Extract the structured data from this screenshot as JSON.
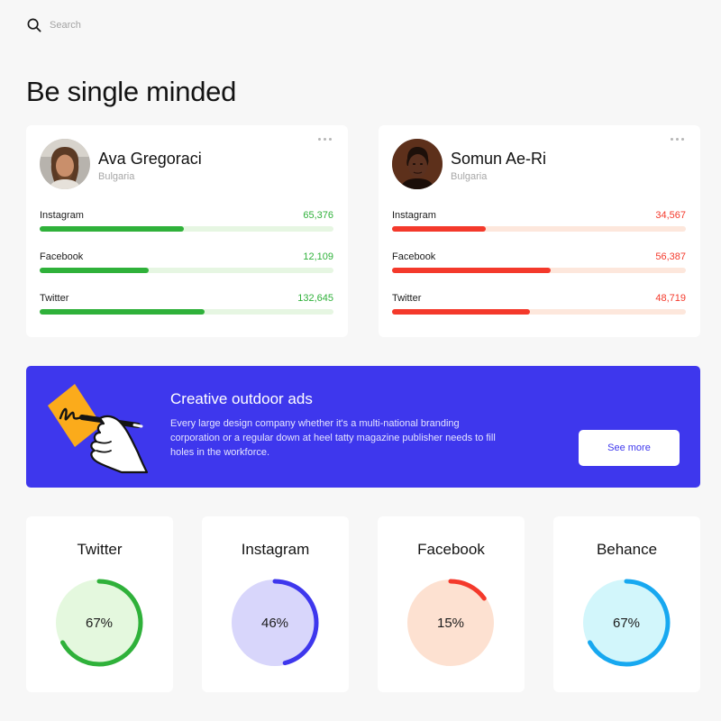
{
  "search": {
    "placeholder": "Search"
  },
  "page": {
    "title": "Be single minded"
  },
  "profiles": [
    {
      "name": "Ava Gregoraci",
      "country": "Bulgaria",
      "accent": "#2fb13a",
      "track": "#e6f6e2",
      "stats": [
        {
          "label": "Instagram",
          "value": "65,376",
          "fill": 0.49
        },
        {
          "label": "Facebook",
          "value": "12,109",
          "fill": 0.37
        },
        {
          "label": "Twitter",
          "value": "132,645",
          "fill": 0.56
        }
      ]
    },
    {
      "name": "Somun Ae-Ri",
      "country": "Bulgaria",
      "accent": "#f4392b",
      "track": "#fde7dc",
      "stats": [
        {
          "label": "Instagram",
          "value": "34,567",
          "fill": 0.32
        },
        {
          "label": "Facebook",
          "value": "56,387",
          "fill": 0.54
        },
        {
          "label": "Twitter",
          "value": "48,719",
          "fill": 0.47
        }
      ]
    }
  ],
  "promo": {
    "title": "Creative outdoor ads",
    "text": "Every large design company whether it's a multi-national branding corporation or a regular down at heel tatty magazine publisher needs to fill holes in the workforce.",
    "button": "See more",
    "background": "#3e37ed"
  },
  "rings": [
    {
      "title": "Twitter",
      "label": "67%",
      "percent": 67,
      "color": "#2fb13a",
      "fill_color": "#e4f8de"
    },
    {
      "title": "Instagram",
      "label": "46%",
      "percent": 46,
      "color": "#3e37ed",
      "fill_color": "#d8d6fb"
    },
    {
      "title": "Facebook",
      "label": "15%",
      "percent": 15,
      "color": "#f4392b",
      "fill_color": "#fde1d1"
    },
    {
      "title": "Behance",
      "label": "67%",
      "percent": 67,
      "color": "#17a8f0",
      "fill_color": "#d2f6fb"
    }
  ]
}
